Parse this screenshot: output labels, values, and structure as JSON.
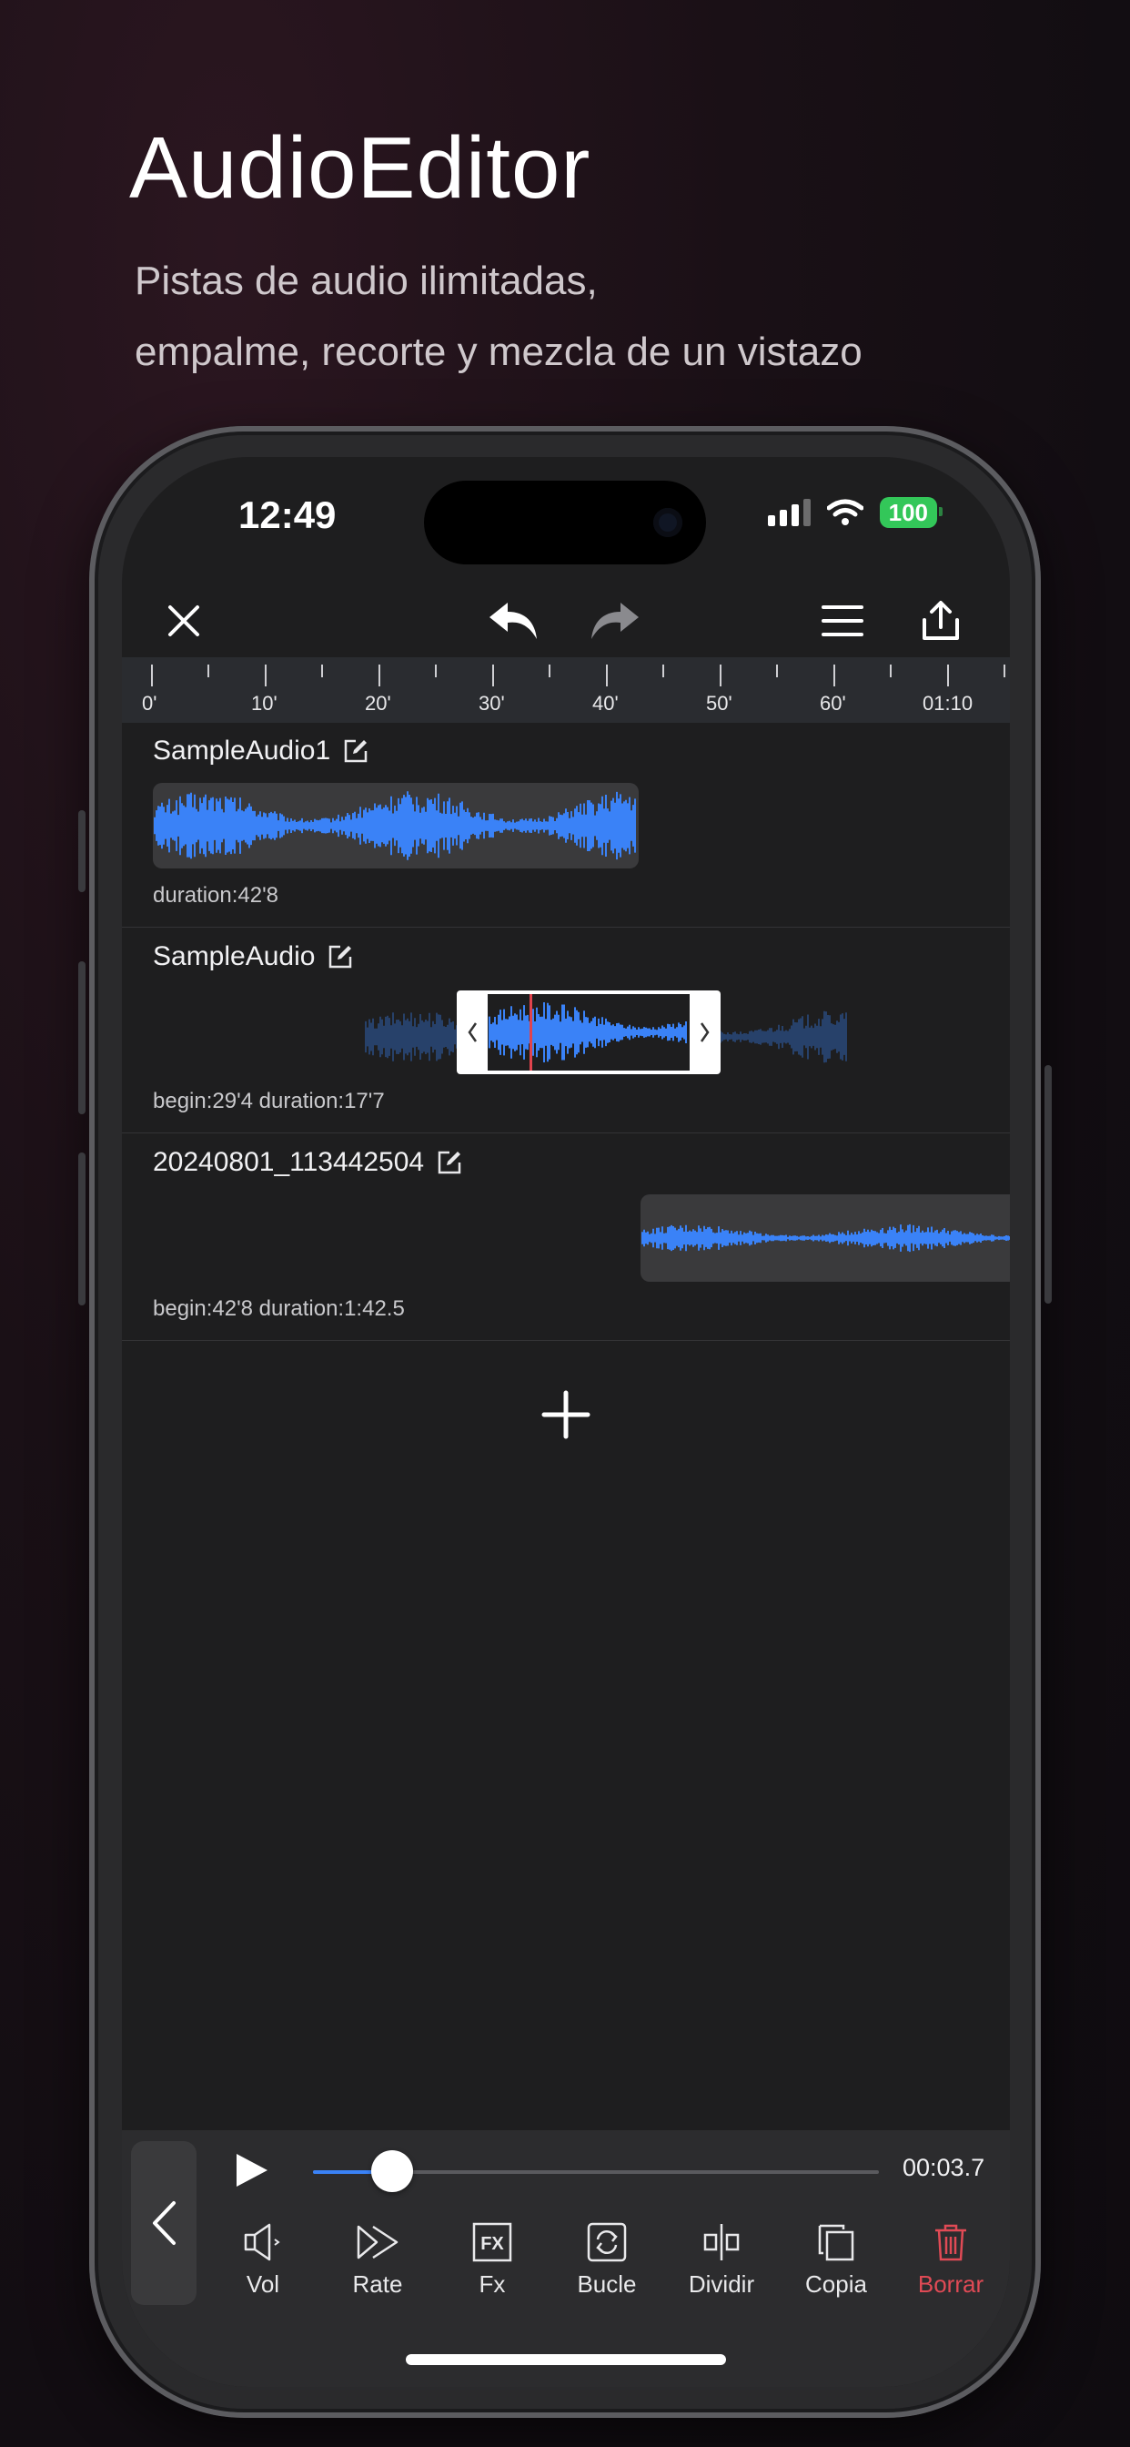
{
  "promo": {
    "title": "AudioEditor",
    "subtitle_line1": "Pistas de audio ilimitadas,",
    "subtitle_line2": "empalme, recorte y mezcla de un vistazo"
  },
  "status_bar": {
    "time": "12:49",
    "battery": "100"
  },
  "toolbar": {
    "close_icon": "close-icon",
    "undo_icon": "undo-icon",
    "redo_icon": "redo-icon",
    "menu_icon": "menu-icon",
    "share_icon": "share-icon"
  },
  "ruler": {
    "labels": [
      "0'",
      "10'",
      "20'",
      "30'",
      "40'",
      "50'",
      "60'",
      "01:10"
    ]
  },
  "tracks": [
    {
      "name": "SampleAudio1",
      "info": "duration:42'8"
    },
    {
      "name": "SampleAudio",
      "info": "begin:29'4  duration:17'7"
    },
    {
      "name": "20240801_113442504",
      "info": "begin:42'8  duration:1:42.5"
    }
  ],
  "player": {
    "time": "00:03.7",
    "progress": 0.14
  },
  "tools": [
    {
      "label": "Vol",
      "icon": "volume-icon"
    },
    {
      "label": "Rate",
      "icon": "rate-icon"
    },
    {
      "label": "Fx",
      "icon": "fx-icon"
    },
    {
      "label": "Bucle",
      "icon": "loop-icon"
    },
    {
      "label": "Dividir",
      "icon": "split-icon"
    },
    {
      "label": "Copia",
      "icon": "copy-icon"
    },
    {
      "label": "Borrar",
      "icon": "trash-icon"
    }
  ],
  "colors": {
    "accent": "#3a82f7",
    "danger": "#e04a55",
    "battery": "#33c759",
    "playhead": "#e0434d"
  }
}
